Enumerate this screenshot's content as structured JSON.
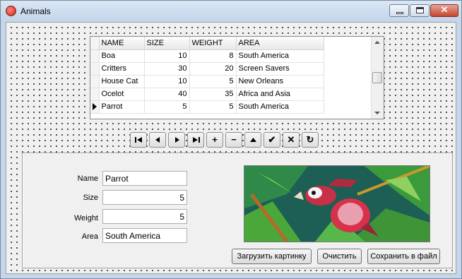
{
  "window": {
    "title": "Animals",
    "close_glyph": "✕"
  },
  "grid": {
    "columns": [
      "NAME",
      "SIZE",
      "WEIGHT",
      "AREA"
    ],
    "rows": [
      {
        "name": "Boa",
        "size": "10",
        "weight": "8",
        "area": "South America",
        "current": false
      },
      {
        "name": "Critters",
        "size": "30",
        "weight": "20",
        "area": "Screen Savers",
        "current": false
      },
      {
        "name": "House Cat",
        "size": "10",
        "weight": "5",
        "area": "New Orleans",
        "current": false
      },
      {
        "name": "Ocelot",
        "size": "40",
        "weight": "35",
        "area": "Africa and Asia",
        "current": false
      },
      {
        "name": "Parrot",
        "size": "5",
        "weight": "5",
        "area": "South America",
        "current": true
      }
    ]
  },
  "navigator": {
    "buttons": [
      {
        "name": "first-record-icon"
      },
      {
        "name": "prior-record-icon"
      },
      {
        "name": "next-record-icon"
      },
      {
        "name": "last-record-icon"
      },
      {
        "name": "insert-record-icon",
        "glyph": "+"
      },
      {
        "name": "delete-record-icon",
        "glyph": "−"
      },
      {
        "name": "edit-record-icon"
      },
      {
        "name": "post-record-icon",
        "glyph": "✔"
      },
      {
        "name": "cancel-edit-icon",
        "glyph": "✕"
      },
      {
        "name": "refresh-icon",
        "glyph": "↻"
      }
    ]
  },
  "form": {
    "name_label": "Name",
    "name_value": "Parrot",
    "size_label": "Size",
    "size_value": "5",
    "weight_label": "Weight",
    "weight_value": "5",
    "area_label": "Area",
    "area_value": "South America"
  },
  "picture": {
    "icon": "parrot-image"
  },
  "buttons": {
    "load_label": "Загрузить картинку",
    "clear_label": "Очистить",
    "save_label": "Сохранить в файл"
  },
  "colors": {
    "title_bar": "#c4d6ea",
    "close_button": "#c7462f",
    "client_background": "#f0f0f0"
  }
}
